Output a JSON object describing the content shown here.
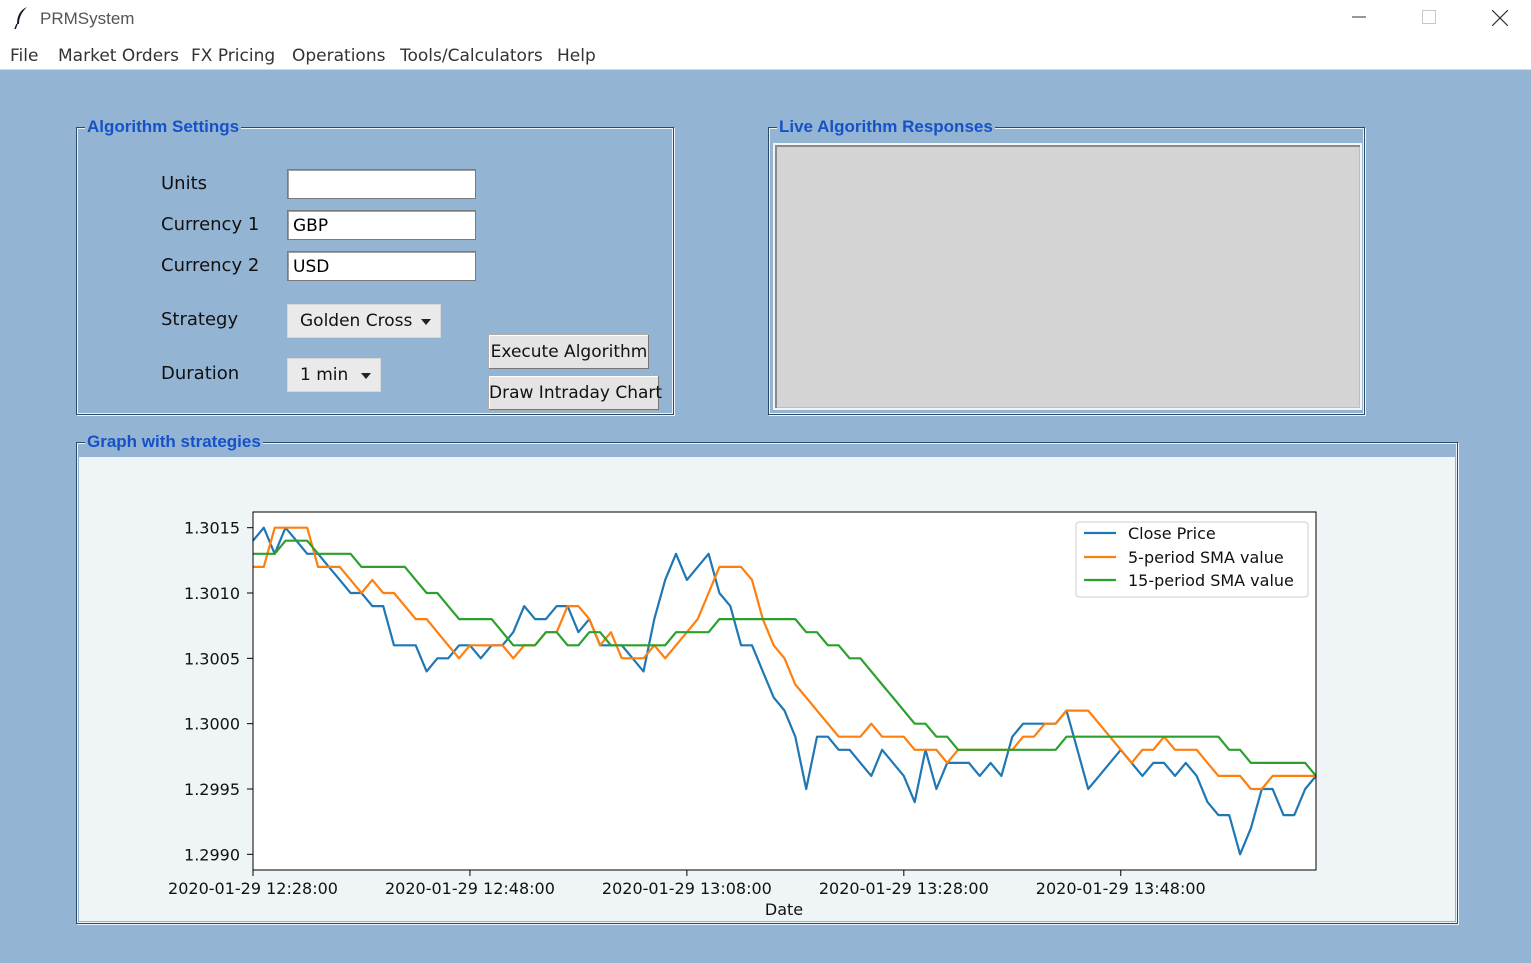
{
  "window": {
    "title": "PRMSystem"
  },
  "menu": {
    "items": [
      "File",
      "Market Orders",
      "FX Pricing",
      "Operations",
      "Tools/Calculators",
      "Help"
    ]
  },
  "algorithm_settings": {
    "title": "Algorithm Settings",
    "units_label": "Units",
    "units_value": "",
    "currency1_label": "Currency 1",
    "currency1_value": "GBP",
    "currency2_label": "Currency 2",
    "currency2_value": "USD",
    "strategy_label": "Strategy",
    "strategy_value": "Golden Cross",
    "duration_label": "Duration",
    "duration_value": "1 min",
    "execute_button": "Execute Algorithm",
    "draw_chart_button": "Draw Intraday Chart"
  },
  "live_responses": {
    "title": "Live Algorithm Responses"
  },
  "graph": {
    "title": "Graph with strategies"
  },
  "colors": {
    "background": "#94b4d4",
    "frame_title": "#1652c6",
    "close_price": "#1f77b4",
    "sma5": "#ff7f0e",
    "sma15": "#2ca02c"
  },
  "chart_data": {
    "type": "line",
    "xlabel": "Date",
    "ylabel": "",
    "x_tick_labels": [
      "2020-01-29 12:28:00",
      "2020-01-29 12:48:00",
      "2020-01-29 13:08:00",
      "2020-01-29 13:28:00",
      "2020-01-29 13:48:00"
    ],
    "x_tick_minutes": [
      0,
      20,
      40,
      60,
      80
    ],
    "xlim_minutes": [
      0,
      98
    ],
    "y_ticks": [
      1.299,
      1.2995,
      1.3,
      1.3005,
      1.301,
      1.3015
    ],
    "ylim": [
      1.29888,
      1.30162
    ],
    "grid": false,
    "legend": "top-right",
    "series": [
      {
        "name": "Close Price",
        "color": "#1f77b4",
        "values": [
          1.3014,
          1.3015,
          1.3013,
          1.3015,
          1.3014,
          1.3013,
          1.3013,
          1.3012,
          1.3011,
          1.301,
          1.301,
          1.3009,
          1.3009,
          1.3006,
          1.3006,
          1.3006,
          1.3004,
          1.3005,
          1.3005,
          1.3006,
          1.3006,
          1.3005,
          1.3006,
          1.3006,
          1.3007,
          1.3009,
          1.3008,
          1.3008,
          1.3009,
          1.3009,
          1.3007,
          1.3008,
          1.3006,
          1.3006,
          1.3006,
          1.3005,
          1.3004,
          1.3008,
          1.3011,
          1.3013,
          1.3011,
          1.3012,
          1.3013,
          1.301,
          1.3009,
          1.3006,
          1.3006,
          1.3004,
          1.3002,
          1.3001,
          1.2999,
          1.2995,
          1.2999,
          1.2999,
          1.2998,
          1.2998,
          1.2997,
          1.2996,
          1.2998,
          1.2997,
          1.2996,
          1.2994,
          1.2998,
          1.2995,
          1.2997,
          1.2997,
          1.2997,
          1.2996,
          1.2997,
          1.2996,
          1.2999,
          1.3,
          1.3,
          1.3,
          1.3,
          1.3001,
          1.2998,
          1.2995,
          1.2996,
          1.2997,
          1.2998,
          1.2997,
          1.2996,
          1.2997,
          1.2997,
          1.2996,
          1.2997,
          1.2996,
          1.2994,
          1.2993,
          1.2993,
          1.299,
          1.2992,
          1.2995,
          1.2995,
          1.2993,
          1.2993,
          1.2995,
          1.2996
        ]
      },
      {
        "name": "5-period SMA value",
        "color": "#ff7f0e",
        "values": [
          1.3012,
          1.3012,
          1.3015,
          1.3015,
          1.3015,
          1.3015,
          1.3012,
          1.3012,
          1.3012,
          1.3011,
          1.301,
          1.3011,
          1.301,
          1.301,
          1.3009,
          1.3008,
          1.3008,
          1.3007,
          1.3006,
          1.3005,
          1.3006,
          1.3006,
          1.3006,
          1.3006,
          1.3005,
          1.3006,
          1.3006,
          1.3007,
          1.3007,
          1.3009,
          1.3009,
          1.3008,
          1.3006,
          1.3007,
          1.3005,
          1.3005,
          1.3005,
          1.3006,
          1.3005,
          1.3006,
          1.3007,
          1.3008,
          1.301,
          1.3012,
          1.3012,
          1.3012,
          1.3011,
          1.3008,
          1.3006,
          1.3005,
          1.3003,
          1.3002,
          1.3001,
          1.3,
          1.2999,
          1.2999,
          1.2999,
          1.3,
          1.2999,
          1.2999,
          1.2999,
          1.2998,
          1.2998,
          1.2998,
          1.2997,
          1.2998,
          1.2998,
          1.2998,
          1.2998,
          1.2998,
          1.2998,
          1.2999,
          1.2999,
          1.3,
          1.3,
          1.3001,
          1.3001,
          1.3001,
          1.3,
          1.2999,
          1.2998,
          1.2997,
          1.2998,
          1.2998,
          1.2999,
          1.2998,
          1.2998,
          1.2998,
          1.2997,
          1.2996,
          1.2996,
          1.2996,
          1.2995,
          1.2995,
          1.2996,
          1.2996,
          1.2996,
          1.2996,
          1.2996
        ]
      },
      {
        "name": "15-period SMA value",
        "color": "#2ca02c",
        "values": [
          1.3013,
          1.3013,
          1.3013,
          1.3014,
          1.3014,
          1.3014,
          1.3013,
          1.3013,
          1.3013,
          1.3013,
          1.3012,
          1.3012,
          1.3012,
          1.3012,
          1.3012,
          1.3011,
          1.301,
          1.301,
          1.3009,
          1.3008,
          1.3008,
          1.3008,
          1.3008,
          1.3007,
          1.3006,
          1.3006,
          1.3006,
          1.3007,
          1.3007,
          1.3006,
          1.3006,
          1.3007,
          1.3007,
          1.3006,
          1.3006,
          1.3006,
          1.3006,
          1.3006,
          1.3006,
          1.3007,
          1.3007,
          1.3007,
          1.3007,
          1.3008,
          1.3008,
          1.3008,
          1.3008,
          1.3008,
          1.3008,
          1.3008,
          1.3008,
          1.3007,
          1.3007,
          1.3006,
          1.3006,
          1.3005,
          1.3005,
          1.3004,
          1.3003,
          1.3002,
          1.3001,
          1.3,
          1.3,
          1.2999,
          1.2999,
          1.2998,
          1.2998,
          1.2998,
          1.2998,
          1.2998,
          1.2998,
          1.2998,
          1.2998,
          1.2998,
          1.2998,
          1.2999,
          1.2999,
          1.2999,
          1.2999,
          1.2999,
          1.2999,
          1.2999,
          1.2999,
          1.2999,
          1.2999,
          1.2999,
          1.2999,
          1.2999,
          1.2999,
          1.2999,
          1.2998,
          1.2998,
          1.2997,
          1.2997,
          1.2997,
          1.2997,
          1.2997,
          1.2997,
          1.2996
        ]
      }
    ]
  }
}
